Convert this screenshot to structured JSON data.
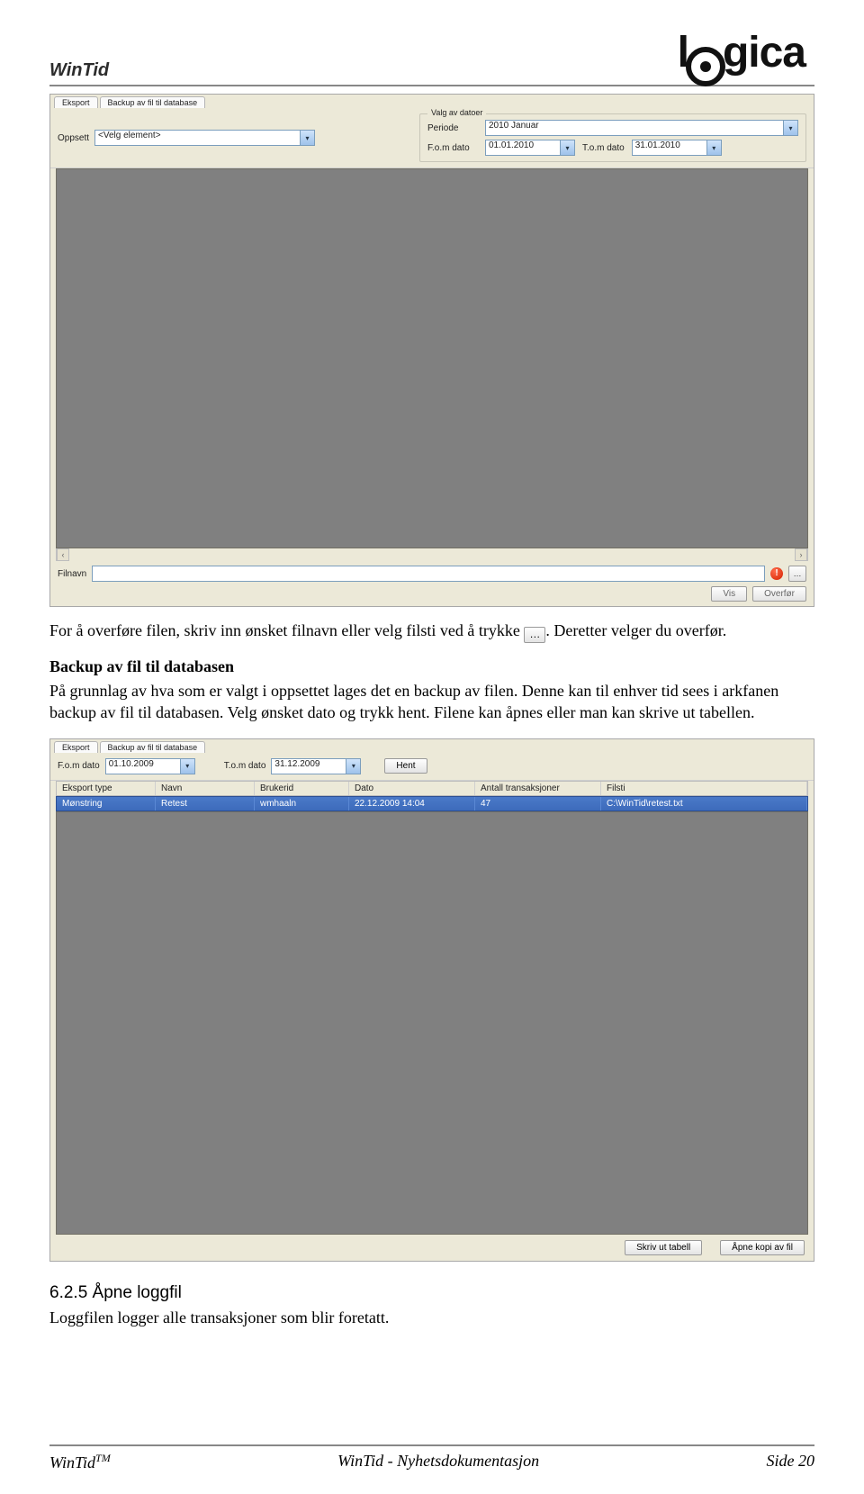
{
  "header": {
    "app_title": "WinTid",
    "logo_text_left": "l",
    "logo_text_right": "gica"
  },
  "screenshot1": {
    "tab1": "Eksport",
    "tab2": "Backup av fil til database",
    "label_oppsett": "Oppsett",
    "select_value": "<Velg element>",
    "group_legend": "Valg av datoer",
    "label_periode": "Periode",
    "periode_value": "2010 Januar",
    "label_fom": "F.o.m dato",
    "fom_value": "01.01.2010",
    "label_tom": "T.o.m dato",
    "tom_value": "31.01.2010",
    "label_filnavn": "Filnavn",
    "btn_vis": "Vis",
    "btn_overfor": "Overfør"
  },
  "body_text": {
    "p1a": "For å overføre filen, skriv inn ønsket filnavn eller velg filsti ved å trykke ",
    "p1b": ". Deretter velger du overfør.",
    "h_backup": "Backup av fil til databasen",
    "p2": "På grunnlag av hva som er valgt i oppsettet lages det en backup av filen. Denne kan til enhver tid sees i arkfanen backup av fil til databasen. Velg ønsket dato og trykk hent. Filene kan åpnes eller man kan skrive ut tabellen."
  },
  "screenshot2": {
    "tab1": "Eksport",
    "tab2": "Backup av fil til database",
    "label_fom": "F.o.m dato",
    "fom_value": "01.10.2009",
    "label_tom": "T.o.m dato",
    "tom_value": "31.12.2009",
    "btn_hent": "Hent",
    "th": [
      "Eksport type",
      "Navn",
      "Brukerid",
      "Dato",
      "Antall transaksjoner",
      "Filsti"
    ],
    "row": [
      "Mønstring",
      "Retest",
      "wmhaaln",
      "22.12.2009 14:04",
      "47",
      "C:\\WinTid\\retest.txt"
    ],
    "btn_skriv": "Skriv ut tabell",
    "btn_apne": "Åpne kopi av fil"
  },
  "section_loggfil": {
    "num_title": "6.2.5  Åpne loggfil",
    "p": "Loggfilen logger alle transaksjoner som blir foretatt."
  },
  "footer": {
    "left": "WinTid",
    "tm": "TM",
    "center": "WinTid - Nyhetsdokumentasjon",
    "right": "Side 20"
  }
}
